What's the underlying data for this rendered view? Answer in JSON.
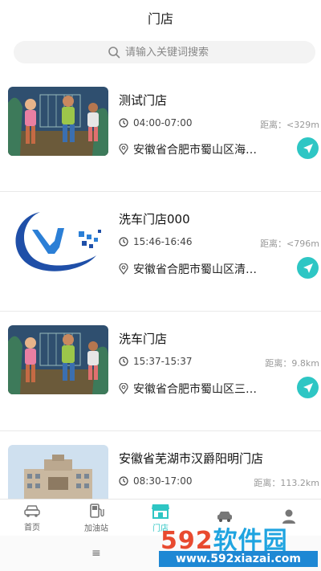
{
  "header": {
    "title": "门店"
  },
  "search": {
    "placeholder": "请输入关键词搜索"
  },
  "stores": [
    {
      "name": "测试门店",
      "hours": "04:00-07:00",
      "distance": "距离：<329m",
      "address": "安徽省合肥市蜀山区海…",
      "thumb": "dancers-illustration"
    },
    {
      "name": "洗车门店000",
      "hours": "15:46-16:46",
      "distance": "距离：<796m",
      "address": "安徽省合肥市蜀山区清…",
      "thumb": "blue-swirl-logo"
    },
    {
      "name": "洗车门店",
      "hours": "15:37-15:37",
      "distance": "距离：9.8km",
      "address": "安徽省合肥市蜀山区三…",
      "thumb": "dancers-illustration"
    },
    {
      "name": "安徽省芜湖市汉爵阳明门店",
      "hours": "08:30-17:00",
      "distance": "距离：113.2km",
      "address": "",
      "thumb": "building-photo"
    }
  ],
  "tabbar": {
    "items": [
      {
        "label": "首页",
        "icon": "car-icon",
        "active": false
      },
      {
        "label": "加油站",
        "icon": "fuel-pump-icon",
        "active": false
      },
      {
        "label": "门店",
        "icon": "store-icon",
        "active": true
      },
      {
        "label": "",
        "icon": "car-service-icon",
        "active": false
      },
      {
        "label": "",
        "icon": "user-icon",
        "active": false
      }
    ]
  },
  "system": {
    "menu_glyph": "≡"
  },
  "watermark": {
    "main_num": "592",
    "main_cn": "软件园",
    "url": "www.592xiazai.com"
  },
  "colors": {
    "accent": "#2ec6c4",
    "watermark_red": "#e84a2f",
    "watermark_blue": "#1e88d4"
  }
}
